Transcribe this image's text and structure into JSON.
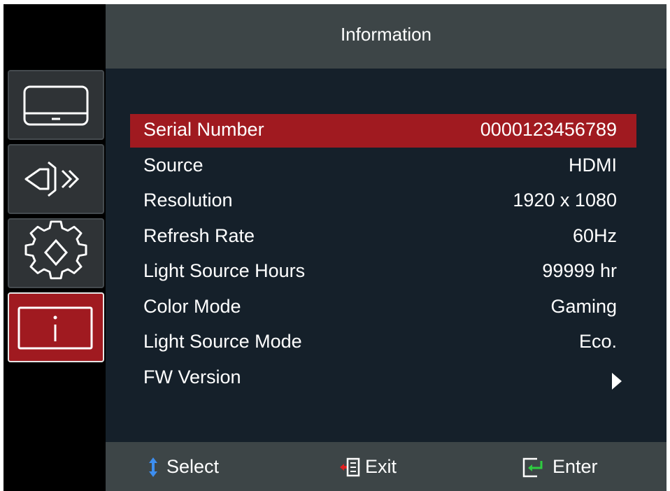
{
  "header": {
    "title": "Information"
  },
  "sidebar": {
    "items": [
      {
        "icon": "display-icon",
        "active": false
      },
      {
        "icon": "audio-icon",
        "active": false
      },
      {
        "icon": "settings-gear-icon",
        "active": false
      },
      {
        "icon": "info-icon",
        "active": true
      }
    ]
  },
  "menu": {
    "rows": [
      {
        "label": "Serial Number",
        "value": "0000123456789",
        "selected": true
      },
      {
        "label": "Source",
        "value": "HDMI"
      },
      {
        "label": "Resolution",
        "value": "1920 x 1080"
      },
      {
        "label": "Refresh Rate",
        "value": "60Hz"
      },
      {
        "label": "Light Source Hours",
        "value": "99999 hr"
      },
      {
        "label": "Color Mode",
        "value": "Gaming"
      },
      {
        "label": "Light Source Mode",
        "value": "Eco."
      },
      {
        "label": "FW Version",
        "value": "",
        "submenu_icon": "right-triangle-icon"
      }
    ]
  },
  "footer": {
    "select_label": "Select",
    "exit_label": "Exit",
    "enter_label": "Enter",
    "select_icon": "up-down-arrow-icon",
    "exit_icon": "exit-icon",
    "enter_icon": "enter-icon"
  },
  "colors": {
    "accent": "#a01a20",
    "header_bg": "#3d4547",
    "panel_bg": "#15202a",
    "sidebar_bg": "#000000",
    "select_arrow": "#3d8ef0",
    "exit_arrow": "#e02020",
    "enter_arrow": "#2ecc40"
  }
}
